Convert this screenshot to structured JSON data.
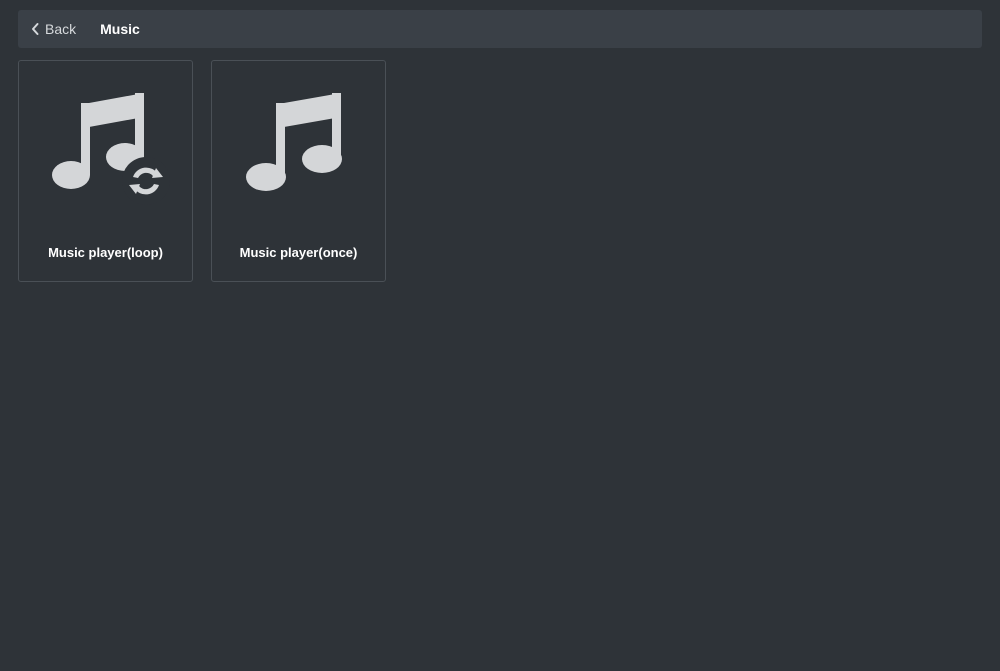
{
  "header": {
    "back_label": "Back",
    "title": "Music"
  },
  "cards": [
    {
      "label": "Music player(loop)",
      "icon": "music-loop-icon"
    },
    {
      "label": "Music player(once)",
      "icon": "music-icon"
    }
  ]
}
